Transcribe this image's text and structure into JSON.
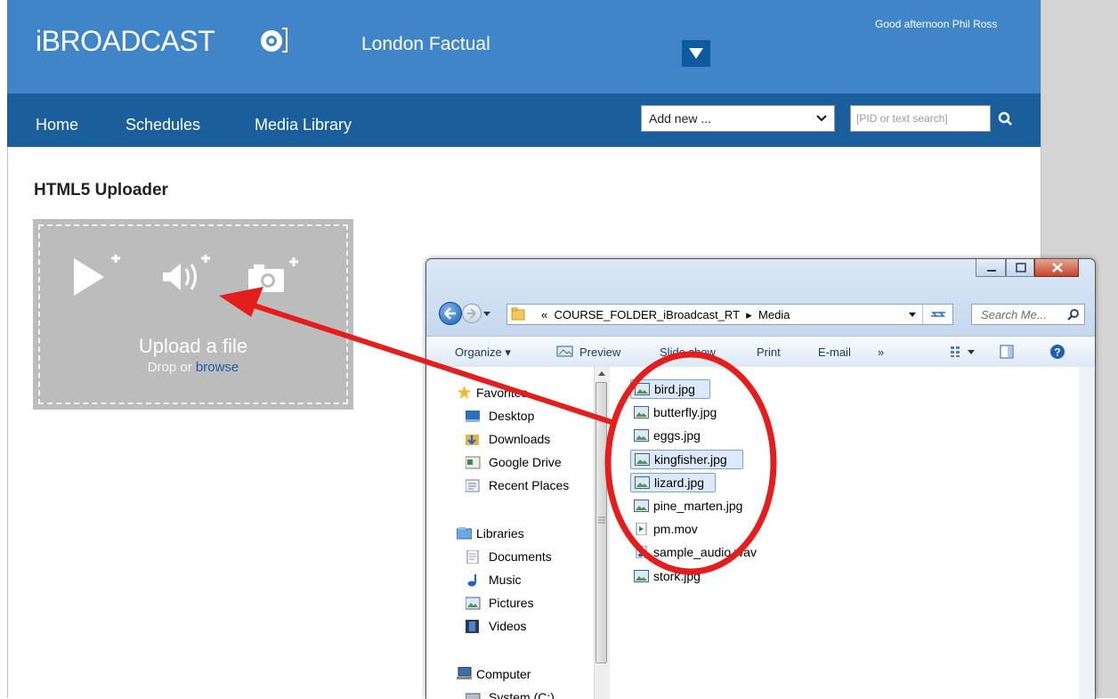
{
  "header": {
    "brand": "iBROADCAST",
    "organization": "London Factual",
    "greeting": "Good afternoon Phil Ross"
  },
  "nav": {
    "items": [
      "Home",
      "Schedules",
      "Media Library"
    ],
    "add_new": "Add new ...",
    "search_placeholder": "[PID or text search]"
  },
  "page": {
    "title": "HTML5 Uploader",
    "upload_title": "Upload a file",
    "upload_drop": "Drop or",
    "upload_browse": "browse"
  },
  "explorer": {
    "path_prefix": "«",
    "path_folder": "COURSE_FOLDER_iBroadcast_RT",
    "path_sep": "▸",
    "path_sub": "Media",
    "search_placeholder": "Search Me...",
    "toolbar": [
      "Organize ▾",
      "Preview",
      "Slide show",
      "Print",
      "E-mail",
      "»"
    ],
    "nav_items": [
      "Favorites",
      "Desktop",
      "Downloads",
      "Google Drive",
      "Recent Places",
      "Libraries",
      "Documents",
      "Music",
      "Pictures",
      "Videos",
      "Computer",
      "System (C:)"
    ],
    "files": [
      {
        "name": "bird.jpg",
        "selected": true,
        "type": "image"
      },
      {
        "name": "butterfly.jpg",
        "selected": false,
        "type": "image"
      },
      {
        "name": "eggs.jpg",
        "selected": false,
        "type": "image"
      },
      {
        "name": "kingfisher.jpg",
        "selected": true,
        "type": "image"
      },
      {
        "name": "lizard.jpg",
        "selected": true,
        "type": "image"
      },
      {
        "name": "pine_marten.jpg",
        "selected": false,
        "type": "image"
      },
      {
        "name": "pm.mov",
        "selected": false,
        "type": "video"
      },
      {
        "name": "sample_audio.wav",
        "selected": false,
        "type": "audio"
      },
      {
        "name": "stork.jpg",
        "selected": false,
        "type": "image"
      }
    ]
  },
  "colors": {
    "header": "#3f85c8",
    "nav": "#1b5e9c",
    "annotation": "#e41d1d"
  }
}
